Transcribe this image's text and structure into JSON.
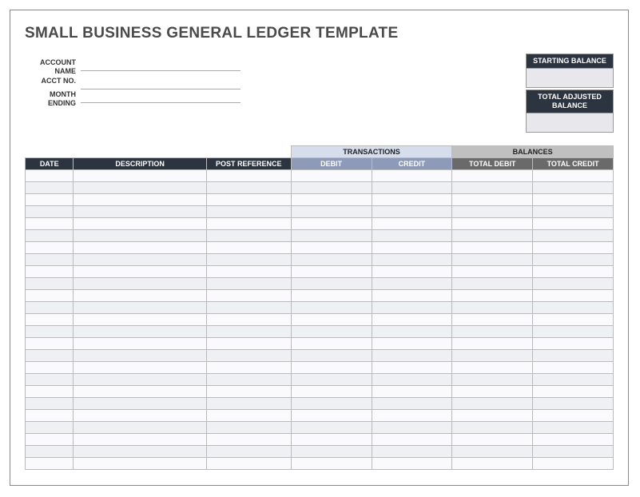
{
  "title": "SMALL BUSINESS GENERAL LEDGER TEMPLATE",
  "fields": {
    "account_name_label": "ACCOUNT NAME",
    "acct_no_label": "ACCT NO.",
    "month_ending_label": "MONTH ENDING",
    "account_name": "",
    "acct_no": "",
    "month_ending": ""
  },
  "balance_boxes": {
    "starting_label": "STARTING BALANCE",
    "starting_value": "",
    "adjusted_label": "TOTAL ADJUSTED BALANCE",
    "adjusted_value": ""
  },
  "table": {
    "super_headers": {
      "transactions": "TRANSACTIONS",
      "balances": "BALANCES"
    },
    "columns": {
      "date": "DATE",
      "description": "DESCRIPTION",
      "post_reference": "POST REFERENCE",
      "debit": "DEBIT",
      "credit": "CREDIT",
      "total_debit": "TOTAL DEBIT",
      "total_credit": "TOTAL CREDIT"
    },
    "row_count": 25
  }
}
